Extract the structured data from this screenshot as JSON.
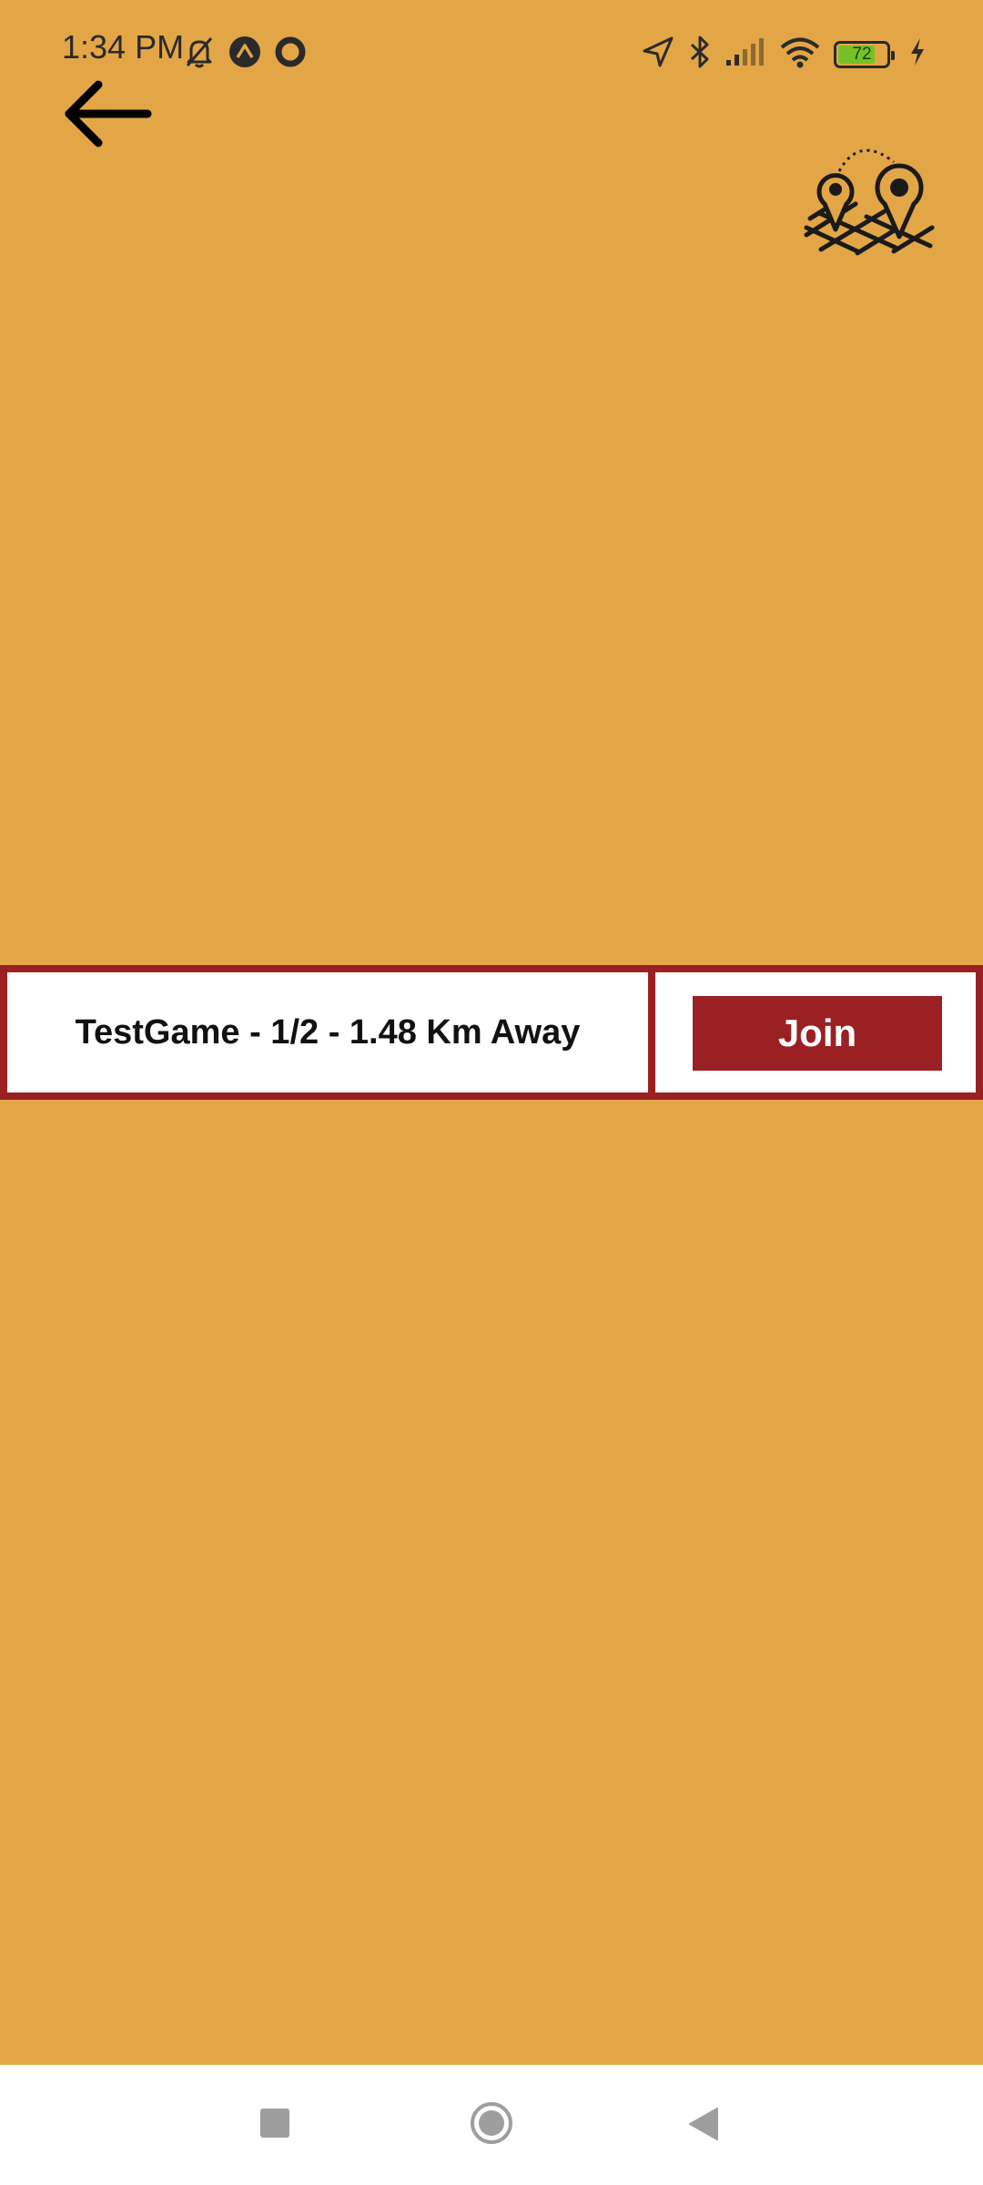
{
  "status_bar": {
    "time": "1:34 PM",
    "battery_level": "72",
    "left_icons": [
      "bell-off-icon",
      "arrow-up-circle-icon",
      "ring-icon"
    ],
    "right_icons": [
      "location-arrow-icon",
      "bluetooth-icon",
      "signal-icon",
      "wifi-icon",
      "battery-icon",
      "charging-bolt-icon"
    ]
  },
  "header": {
    "back_icon": "arrow-left-icon",
    "logo_icon": "map-pins-icon"
  },
  "games": [
    {
      "label": "TestGame - 1/2 - 1.48 Km Away",
      "join_label": "Join"
    }
  ],
  "nav_bar": {
    "icons": [
      "recents-square-icon",
      "home-circle-icon",
      "back-triangle-icon"
    ]
  },
  "colors": {
    "background": "#E3A646",
    "accent": "#9A2023",
    "surface": "#FFFFFF",
    "battery_fill": "#76C226"
  }
}
